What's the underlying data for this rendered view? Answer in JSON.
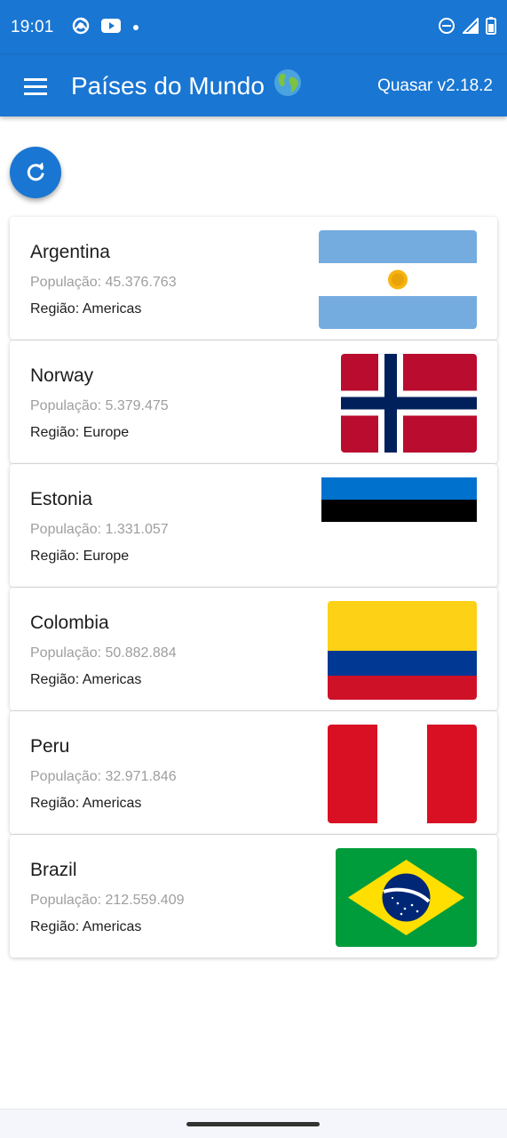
{
  "status_bar": {
    "time": "19:01",
    "icons_left": [
      "chrome-icon",
      "youtube-icon",
      "notification-dot-icon"
    ],
    "icons_right": [
      "do-not-disturb-icon",
      "signal-icon",
      "battery-icon"
    ]
  },
  "app_bar": {
    "title": "Países do Mundo",
    "title_icon": "globe-icon",
    "version": "Quasar v2.18.2"
  },
  "refresh_button": {
    "icon": "refresh-icon"
  },
  "countries": [
    {
      "name": "Argentina",
      "population": "População: 45.376.763",
      "region": "Região: Americas",
      "flag": "argentina-flag"
    },
    {
      "name": "Norway",
      "population": "População: 5.379.475",
      "region": "Região: Europe",
      "flag": "norway-flag"
    },
    {
      "name": "Estonia",
      "population": "População: 1.331.057",
      "region": "Região: Europe",
      "flag": "estonia-flag"
    },
    {
      "name": "Colombia",
      "population": "População: 50.882.884",
      "region": "Região: Americas",
      "flag": "colombia-flag"
    },
    {
      "name": "Peru",
      "population": "População: 32.971.846",
      "region": "Região: Americas",
      "flag": "peru-flag"
    },
    {
      "name": "Brazil",
      "population": "População: 212.559.409",
      "region": "Região: Americas",
      "flag": "brazil-flag"
    }
  ],
  "colors": {
    "primary": "#1976d2",
    "text_primary": "#1d1d1d",
    "text_secondary": "#9e9e9e"
  }
}
